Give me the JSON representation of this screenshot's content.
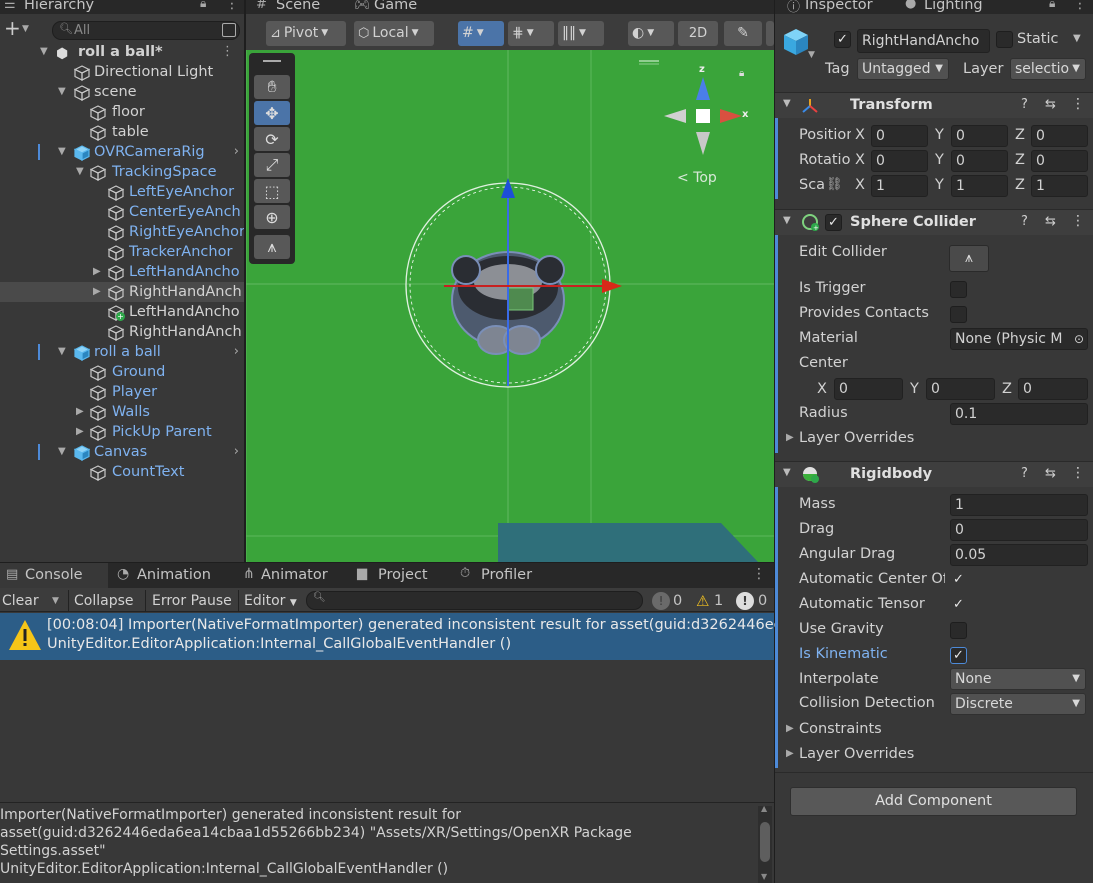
{
  "hierarchy": {
    "tab_label": "Hierarchy",
    "search_placeholder": "All",
    "items": [
      {
        "label": "roll a ball*",
        "indent": 0
      },
      {
        "label": "Directional Light"
      },
      {
        "label": "scene"
      },
      {
        "label": "floor"
      },
      {
        "label": "table"
      },
      {
        "label": "OVRCameraRig"
      },
      {
        "label": "TrackingSpace"
      },
      {
        "label": "LeftEyeAnchor"
      },
      {
        "label": "CenterEyeAnch"
      },
      {
        "label": "RightEyeAnchor"
      },
      {
        "label": "TrackerAnchor"
      },
      {
        "label": "LeftHandAncho"
      },
      {
        "label": "RightHandAnch"
      },
      {
        "label": "LeftHandAncho"
      },
      {
        "label": "RightHandAnch"
      },
      {
        "label": "roll a ball"
      },
      {
        "label": "Ground"
      },
      {
        "label": "Player"
      },
      {
        "label": "Walls"
      },
      {
        "label": "PickUp Parent"
      },
      {
        "label": "Canvas"
      },
      {
        "label": "CountText"
      }
    ]
  },
  "scene": {
    "tab_scene": "Scene",
    "tab_game": "Game",
    "pivot": "Pivot",
    "local": "Local",
    "mode_2d": "2D",
    "gizmo_view": "Top",
    "axis_x": "x",
    "axis_z": "z",
    "colors": {
      "background": "#3aa43a"
    }
  },
  "console": {
    "tabs": [
      "Console",
      "Animation",
      "Animator",
      "Project",
      "Profiler"
    ],
    "clear": "Clear",
    "collapse": "Collapse",
    "error_pause": "Error Pause",
    "editor": "Editor",
    "count_log": "0",
    "count_warn": "1",
    "count_error": "0",
    "entry_line1": "[00:08:04] Importer(NativeFormatImporter) generated inconsistent result for asset(guid:d3262446eda",
    "entry_line2": "UnityEditor.EditorApplication:Internal_CallGlobalEventHandler ()",
    "detail_lines": [
      "Importer(NativeFormatImporter) generated inconsistent result for",
      "asset(guid:d3262446eda6ea14cbaa1d55266bb234) \"Assets/XR/Settings/OpenXR Package",
      "Settings.asset\"",
      "UnityEditor.EditorApplication:Internal_CallGlobalEventHandler ()"
    ]
  },
  "inspector": {
    "tab_inspector": "Inspector",
    "tab_lighting": "Lighting",
    "object_name": "RightHandAncho",
    "static_label": "Static",
    "tag_label": "Tag",
    "tag_value": "Untagged",
    "layer_label": "Layer",
    "layer_value": "selectio",
    "transform": {
      "title": "Transform",
      "position_label": "Position",
      "rotation_label": "Rotatio",
      "scale_label": "Sca",
      "position": [
        "0",
        "0",
        "0"
      ],
      "rotation": [
        "0",
        "0",
        "0"
      ],
      "scale": [
        "1",
        "1",
        "1"
      ]
    },
    "axis_labels": [
      "X",
      "Y",
      "Z"
    ],
    "sphere_collider": {
      "title": "Sphere Collider",
      "edit_collider": "Edit Collider",
      "is_trigger": "Is Trigger",
      "provides_contacts": "Provides Contacts",
      "material_label": "Material",
      "material_value": "None (Physic M",
      "center_label": "Center",
      "center": [
        "0",
        "0",
        "0"
      ],
      "radius_label": "Radius",
      "radius": "0.1",
      "layer_overrides": "Layer Overrides"
    },
    "rigidbody": {
      "title": "Rigidbody",
      "mass_label": "Mass",
      "mass": "1",
      "drag_label": "Drag",
      "drag": "0",
      "angular_drag_label": "Angular Drag",
      "angular_drag": "0.05",
      "auto_center_label": "Automatic Center Of",
      "auto_tensor_label": "Automatic Tensor",
      "use_gravity_label": "Use Gravity",
      "is_kinematic_label": "Is Kinematic",
      "interpolate_label": "Interpolate",
      "interpolate": "None",
      "collision_label": "Collision Detection",
      "collision": "Discrete",
      "constraints": "Constraints",
      "layer_overrides": "Layer Overrides"
    },
    "add_component": "Add Component"
  }
}
